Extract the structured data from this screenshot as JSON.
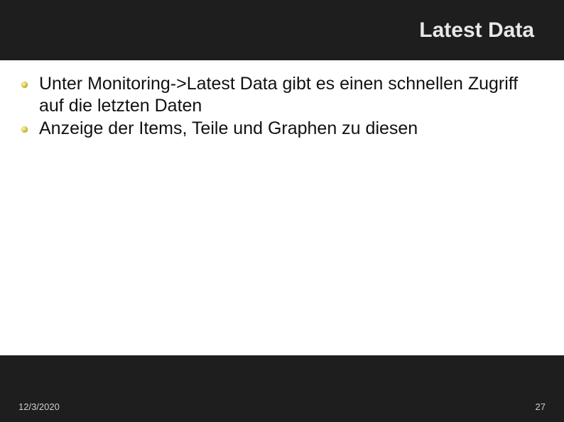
{
  "header": {
    "title": "Latest Data"
  },
  "content": {
    "bullets": [
      "Unter Monitoring->Latest Data gibt es einen schnellen Zugriff auf die letzten Daten",
      "Anzeige der Items, Teile und Graphen zu diesen"
    ]
  },
  "footer": {
    "date": "12/3/2020",
    "page": "27"
  }
}
